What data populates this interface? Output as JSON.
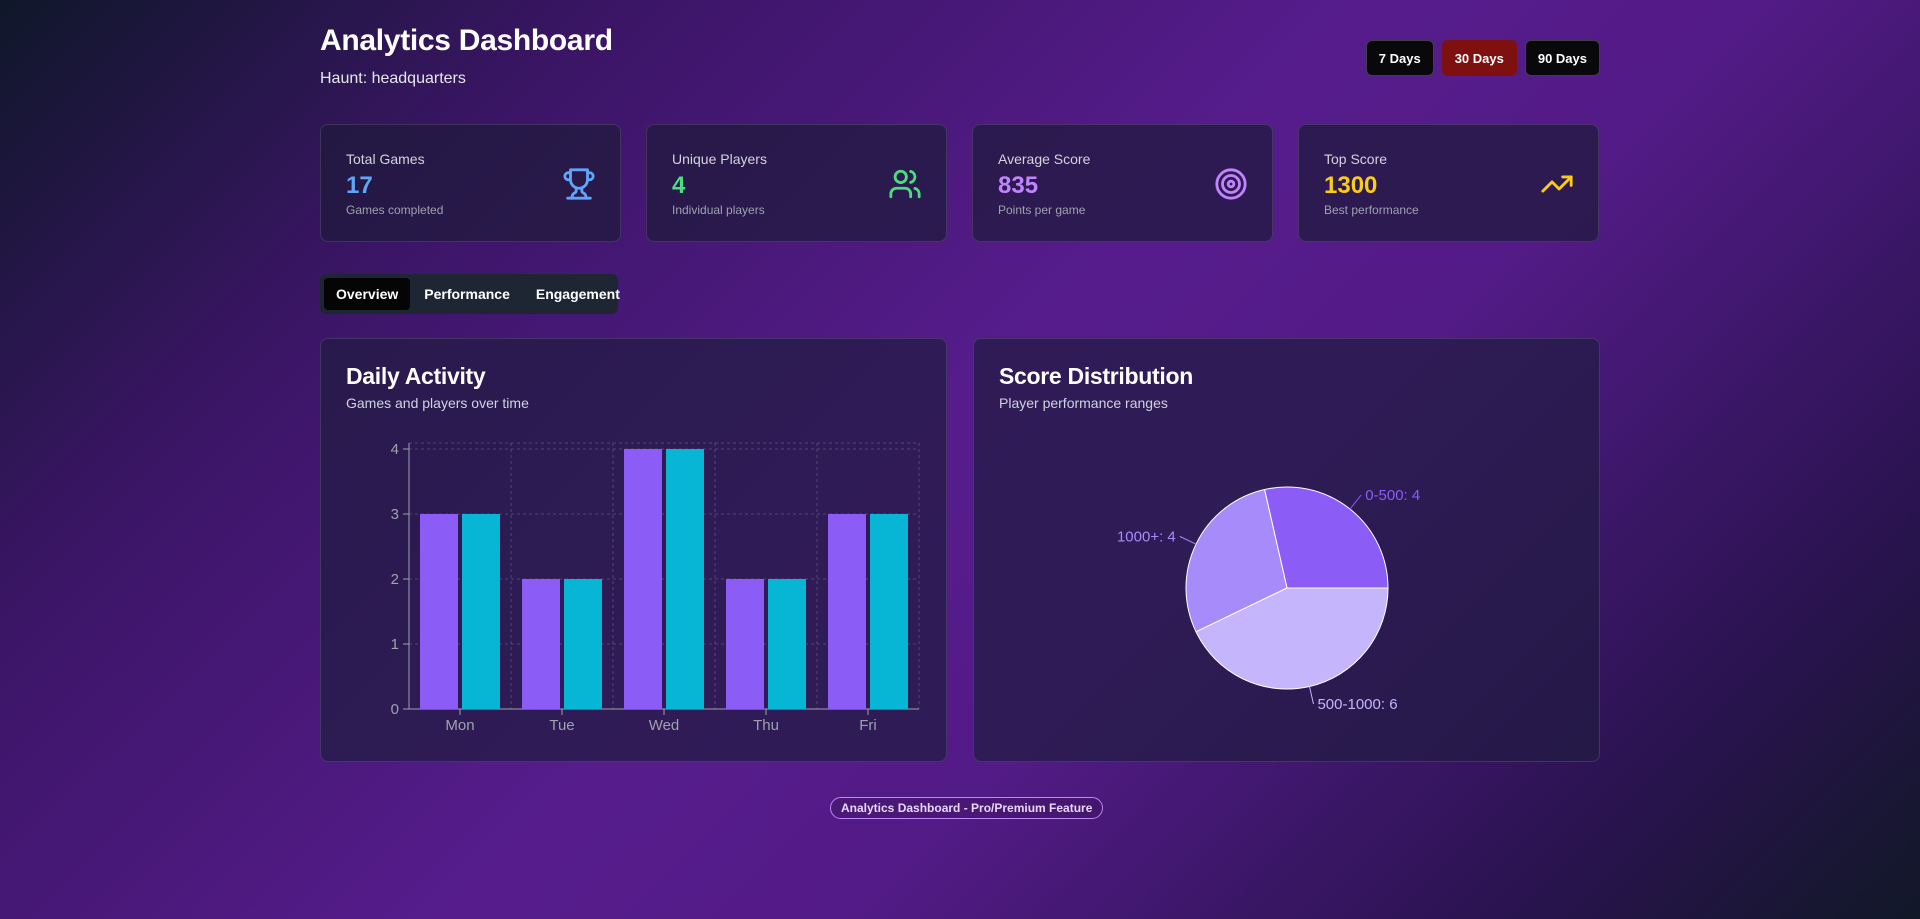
{
  "header": {
    "title": "Analytics Dashboard",
    "subtitle": "Haunt: headquarters",
    "ranges": [
      "7 Days",
      "30 Days",
      "90 Days"
    ],
    "active_range": "30 Days"
  },
  "stats": [
    {
      "label": "Total Games",
      "value": "17",
      "desc": "Games completed",
      "color": "#60a5fa",
      "icon": "trophy-icon"
    },
    {
      "label": "Unique Players",
      "value": "4",
      "desc": "Individual players",
      "color": "#4ade80",
      "icon": "users-icon"
    },
    {
      "label": "Average Score",
      "value": "835",
      "desc": "Points per game",
      "color": "#c084fc",
      "icon": "target-icon"
    },
    {
      "label": "Top Score",
      "value": "1300",
      "desc": "Best performance",
      "color": "#facc15",
      "icon": "trending-up-icon"
    }
  ],
  "tabs": [
    "Overview",
    "Performance",
    "Engagement"
  ],
  "active_tab": "Overview",
  "daily_activity": {
    "title": "Daily Activity",
    "subtitle": "Games and players over time"
  },
  "score_distribution": {
    "title": "Score Distribution",
    "subtitle": "Player performance ranges"
  },
  "footer": {
    "badge": "Analytics Dashboard - Pro/Premium Feature"
  },
  "colors": {
    "series_a": "#8b5cf6",
    "series_b": "#06b6d4",
    "pie": [
      "#8b5cf6",
      "#a78bfa",
      "#c4b5fd"
    ],
    "active_range": "#7f1010"
  },
  "chart_data": [
    {
      "type": "bar",
      "categories": [
        "Mon",
        "Tue",
        "Wed",
        "Thu",
        "Fri"
      ],
      "series": [
        {
          "values": [
            3,
            2,
            4,
            2,
            3
          ]
        },
        {
          "values": [
            3,
            2,
            4,
            2,
            3
          ]
        }
      ],
      "yticks": [
        0,
        1,
        2,
        3,
        4
      ],
      "ylim": [
        0,
        4
      ],
      "grid": true
    },
    {
      "type": "pie",
      "slices": [
        {
          "label": "0-500: 4",
          "value": 4
        },
        {
          "label": "1000+: 4",
          "value": 4
        },
        {
          "label": "500-1000: 6",
          "value": 6
        }
      ]
    }
  ]
}
